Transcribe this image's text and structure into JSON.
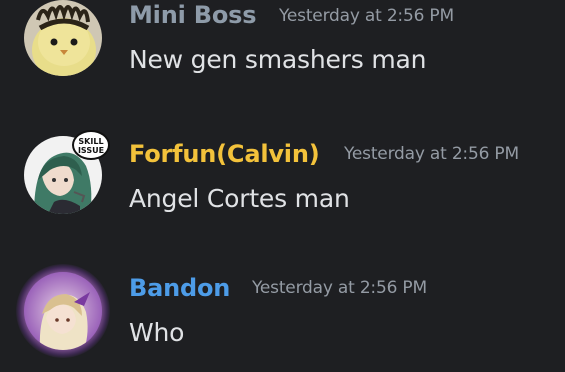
{
  "messages": [
    {
      "author": "Mini Boss",
      "author_color": "#8e9ba9",
      "timestamp": "Yesterday at 2:56 PM",
      "text": "New gen smashers man",
      "avatar_icon": "chick-avatar"
    },
    {
      "author": "Forfun(Calvin)",
      "author_color": "#f3c23b",
      "timestamp": "Yesterday at 2:56 PM",
      "text": "Angel Cortes man",
      "avatar_icon": "anime-character-avatar",
      "avatar_badge": "SKILL ISSUE"
    },
    {
      "author": "Bandon",
      "author_color": "#4d9ce8",
      "timestamp": "Yesterday at 2:56 PM",
      "text": "Who",
      "avatar_icon": "anime-character-avatar",
      "avatar_decoration": "purple-glow-frame"
    }
  ]
}
